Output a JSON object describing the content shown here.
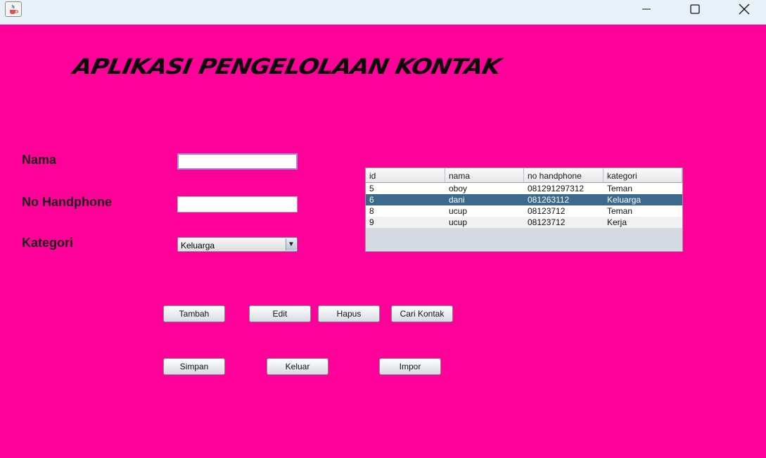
{
  "window": {
    "app_icon": "java-coffee-cup-icon",
    "controls": {
      "minimize": "minimize-icon",
      "maximize": "maximize-icon",
      "close": "close-icon"
    }
  },
  "title": "APLIKASI PENGELOLAAN KONTAK",
  "form": {
    "nama_label": "Nama",
    "nama_value": "",
    "nohp_label": "No Handphone",
    "nohp_value": "",
    "kategori_label": "Kategori",
    "kategori_selected": "Keluarga"
  },
  "table": {
    "columns": [
      "id",
      "nama",
      "no handphone",
      "kategori"
    ],
    "rows": [
      [
        "5",
        "oboy",
        "081291297312",
        "Teman"
      ],
      [
        "6",
        "dani",
        "081263112",
        "Keluarga"
      ],
      [
        "8",
        "ucup",
        "08123712",
        "Teman"
      ],
      [
        "9",
        "ucup",
        "08123712",
        "Kerja"
      ]
    ],
    "selected_row": 1
  },
  "buttons": {
    "tambah": "Tambah",
    "edit": "Edit",
    "hapus": "Hapus",
    "cari": "Cari Kontak",
    "simpan": "Simpan",
    "keluar": "Keluar",
    "impor": "Impor"
  },
  "colors": {
    "background": "#ff0099",
    "selection": "#3b6a8d",
    "titlebar": "#e8f1f8"
  }
}
